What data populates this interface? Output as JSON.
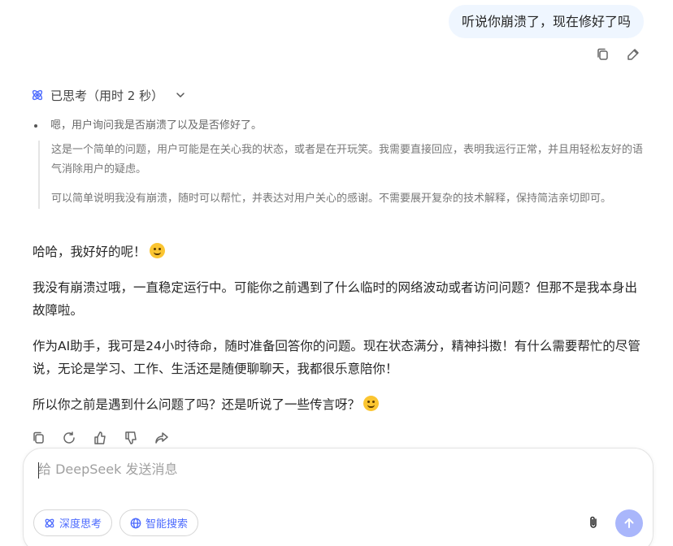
{
  "user_message": {
    "text": "听说你崩溃了，现在修好了吗"
  },
  "thinking": {
    "header": "已思考（用时 2 秒）",
    "bullet": "嗯，用户询问我是否崩溃了以及是否修好了。",
    "paragraphs": [
      "这是一个简单的问题，用户可能是在关心我的状态，或者是在开玩笑。我需要直接回应，表明我运行正常，并且用轻松友好的语气消除用户的疑虑。",
      "可以简单说明我没有崩溃，随时可以帮忙，并表达对用户关心的感谢。不需要展开复杂的技术解释，保持简洁亲切即可。"
    ]
  },
  "answer": {
    "p1": "哈哈，我好好的呢！",
    "p2": "我没有崩溃过哦，一直稳定运行中。可能你之前遇到了什么临时的网络波动或者访问问题？但那不是我本身出故障啦。",
    "p3": "作为AI助手，我可是24小时待命，随时准备回答你的问题。现在状态满分，精神抖擞！有什么需要帮忙的尽管说，无论是学习、工作、生活还是随便聊聊天，我都很乐意陪你！",
    "p4": "所以你之前是遇到什么问题了吗？还是听说了一些传言呀？"
  },
  "composer": {
    "placeholder": "给 DeepSeek 发送消息",
    "deep_think_label": "深度思考",
    "web_search_label": "智能搜索"
  },
  "colors": {
    "accent": "#4d6bfe",
    "user_bubble": "#eff6ff",
    "send_disabled": "#a9b6fb"
  }
}
